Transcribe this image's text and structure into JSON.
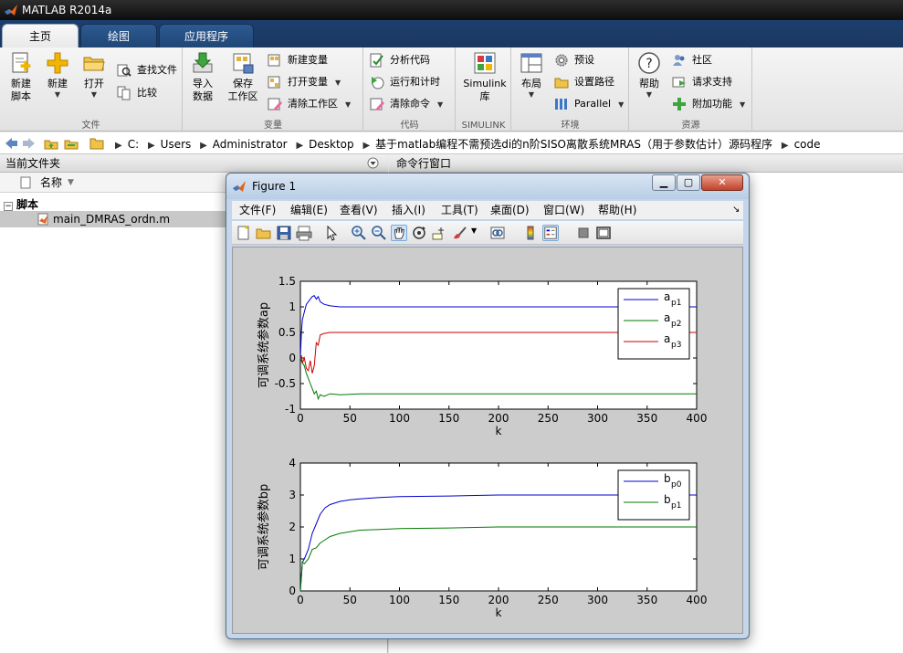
{
  "app": {
    "title": "MATLAB R2014a"
  },
  "tabs": [
    {
      "label": "主页",
      "active": true
    },
    {
      "label": "绘图"
    },
    {
      "label": "应用程序"
    }
  ],
  "ribbon": {
    "file_group": {
      "label": "文件",
      "new_script": [
        "新建",
        "脚本"
      ],
      "new": "新建",
      "open": "打开",
      "find_files": "查找文件",
      "compare": "比较"
    },
    "variable_group": {
      "label": "变量",
      "import": [
        "导入",
        "数据"
      ],
      "save_ws": [
        "保存",
        "工作区"
      ],
      "new_var": "新建变量",
      "open_var": "打开变量",
      "clear_ws": "清除工作区"
    },
    "code_group": {
      "label": "代码",
      "analyze": "分析代码",
      "run_time": "运行和计时",
      "clear_cmd": "清除命令"
    },
    "simulink_group": {
      "label": "SIMULINK",
      "simulink": [
        "Simulink",
        "库"
      ]
    },
    "env_group": {
      "label": "环境",
      "layout": "布局",
      "prefs": "预设",
      "set_path": "设置路径",
      "parallel": "Parallel"
    },
    "resources_group": {
      "label": "资源",
      "help": "帮助",
      "community": "社区",
      "support": "请求支持",
      "addons": "附加功能"
    }
  },
  "path": {
    "crumbs": [
      "C:",
      "Users",
      "Administrator",
      "Desktop",
      "基于matlab编程不需预选di的n阶SISO离散系统MRAS（用于参数估计）源码程序",
      "code"
    ]
  },
  "left_panel": {
    "title": "当前文件夹",
    "col_name": "名称",
    "group": "脚本",
    "file": "main_DMRAS_ordn.m"
  },
  "right_panel": {
    "title": "命令行窗口"
  },
  "figure": {
    "title": "Figure 1",
    "menu": [
      "文件(F)",
      "编辑(E)",
      "查看(V)",
      "插入(I)",
      "工具(T)",
      "桌面(D)",
      "窗口(W)",
      "帮助(H)"
    ]
  },
  "chart_data": [
    {
      "type": "line",
      "xlabel": "k",
      "ylabel": "可调系统参数ap",
      "xlim": [
        0,
        400
      ],
      "ylim": [
        -1,
        1.5
      ],
      "xticks": [
        "0",
        "50",
        "100",
        "150",
        "200",
        "250",
        "300",
        "350",
        "400"
      ],
      "yticks": [
        "-1",
        "-0.5",
        "0",
        "0.5",
        "1",
        "1.5"
      ],
      "legend": "top-right",
      "series": [
        {
          "name": "a",
          "sub": "p1",
          "color": "#0000cc",
          "x": [
            0,
            1,
            2,
            4,
            6,
            8,
            10,
            12,
            14,
            16,
            18,
            20,
            24,
            30,
            40,
            60,
            400
          ],
          "y": [
            0,
            0.5,
            0.75,
            0.9,
            1.05,
            1.1,
            1.15,
            1.2,
            1.22,
            1.15,
            1.2,
            1.1,
            1.05,
            1.02,
            1.0,
            1.0,
            1.0
          ]
        },
        {
          "name": "a",
          "sub": "p2",
          "color": "#007a00",
          "x": [
            0,
            1,
            2,
            4,
            6,
            8,
            10,
            12,
            14,
            16,
            18,
            20,
            24,
            30,
            40,
            60,
            400
          ],
          "y": [
            0,
            -0.05,
            -0.1,
            -0.15,
            -0.3,
            -0.4,
            -0.5,
            -0.6,
            -0.7,
            -0.65,
            -0.8,
            -0.72,
            -0.75,
            -0.7,
            -0.72,
            -0.7,
            -0.7
          ]
        },
        {
          "name": "a",
          "sub": "p3",
          "color": "#cc0000",
          "x": [
            0,
            1,
            2,
            4,
            6,
            8,
            10,
            12,
            14,
            16,
            18,
            20,
            24,
            30,
            40,
            60,
            400
          ],
          "y": [
            0,
            0.05,
            -0.1,
            0.0,
            -0.2,
            -0.25,
            -0.05,
            -0.3,
            -0.15,
            0.3,
            0.25,
            0.45,
            0.48,
            0.5,
            0.5,
            0.5,
            0.5
          ]
        }
      ]
    },
    {
      "type": "line",
      "xlabel": "k",
      "ylabel": "可调系统参数bp",
      "xlim": [
        0,
        400
      ],
      "ylim": [
        0,
        4
      ],
      "xticks": [
        "0",
        "50",
        "100",
        "150",
        "200",
        "250",
        "300",
        "350",
        "400"
      ],
      "yticks": [
        "0",
        "1",
        "2",
        "3",
        "4"
      ],
      "legend": "top-right",
      "series": [
        {
          "name": "b",
          "sub": "p0",
          "color": "#0000cc",
          "x": [
            0,
            2,
            4,
            8,
            12,
            16,
            20,
            25,
            30,
            40,
            50,
            60,
            80,
            100,
            150,
            200,
            400
          ],
          "y": [
            0,
            0.9,
            1.0,
            1.3,
            1.8,
            2.1,
            2.4,
            2.6,
            2.7,
            2.8,
            2.85,
            2.88,
            2.92,
            2.95,
            2.97,
            3.0,
            3.0
          ]
        },
        {
          "name": "b",
          "sub": "p1",
          "color": "#007a00",
          "x": [
            0,
            2,
            4,
            8,
            12,
            16,
            20,
            25,
            30,
            40,
            50,
            60,
            80,
            100,
            150,
            200,
            400
          ],
          "y": [
            0,
            0.9,
            0.85,
            1.0,
            1.3,
            1.35,
            1.5,
            1.6,
            1.7,
            1.8,
            1.85,
            1.9,
            1.92,
            1.95,
            1.97,
            2.0,
            2.0
          ]
        }
      ]
    }
  ]
}
